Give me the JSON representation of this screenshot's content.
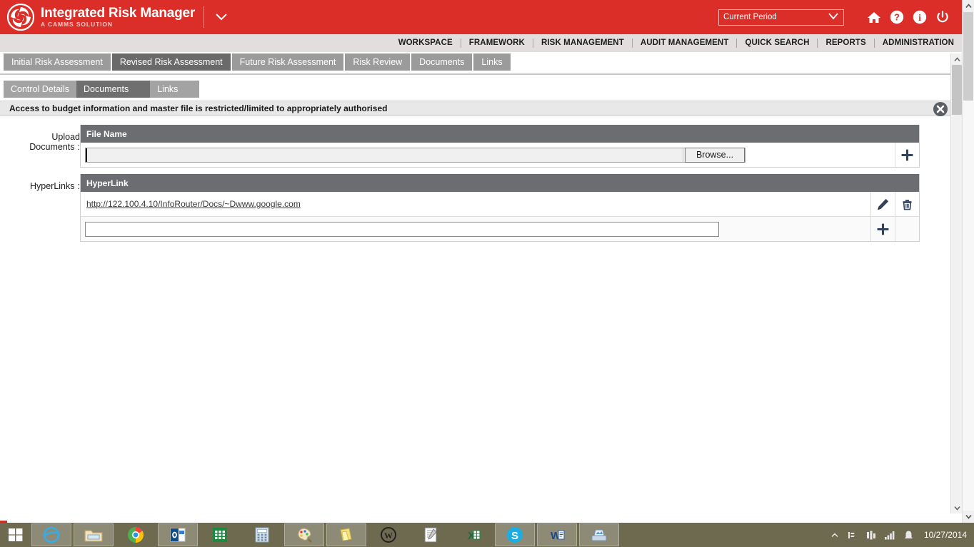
{
  "header": {
    "brand_title": "Integrated Risk Manager",
    "brand_subtitle": "A CAMMS SOLUTION",
    "period_selected": "Current Period",
    "icons": [
      "home-icon",
      "help-icon",
      "info-icon",
      "power-icon"
    ]
  },
  "nav": {
    "items": [
      "WORKSPACE",
      "FRAMEWORK",
      "RISK MANAGEMENT",
      "AUDIT MANAGEMENT",
      "QUICK SEARCH",
      "REPORTS",
      "ADMINISTRATION"
    ]
  },
  "tabs_primary": [
    {
      "label": "Initial Risk Assessment",
      "active": false
    },
    {
      "label": "Revised Risk Assessment",
      "active": true
    },
    {
      "label": "Future Risk Assessment",
      "active": false
    },
    {
      "label": "Risk Review",
      "active": false
    },
    {
      "label": "Documents",
      "active": false
    },
    {
      "label": "Links",
      "active": false
    }
  ],
  "tabs_secondary": [
    {
      "label": "Control Details",
      "active": false
    },
    {
      "label": "Documents",
      "active": true
    },
    {
      "label": "Links",
      "active": false
    }
  ],
  "subheader": {
    "text": "Access to budget information and master file is restricted/limited to appropriately authorised",
    "close_icon": "close-circle-icon"
  },
  "upload_documents": {
    "label": "Upload Documents",
    "colon": ":",
    "column_header": "File Name",
    "file_value": "",
    "browse_label": "Browse...",
    "add_icon": "plus-icon"
  },
  "hyperlinks": {
    "label": "HyperLinks",
    "colon": ":",
    "column_header": "HyperLink",
    "rows": [
      {
        "url": "http://122.100.4.10/InfoRouter/Docs/~Dwww.google.com",
        "edit_icon": "pencil-icon",
        "delete_icon": "trash-icon"
      }
    ],
    "new_value": "",
    "add_icon": "plus-icon"
  },
  "taskbar": {
    "start_label": "start-button",
    "items": [
      "internet-explorer-icon",
      "file-explorer-icon",
      "chrome-icon",
      "outlook-icon",
      "excel-green-icon",
      "calculator-icon",
      "paint-icon",
      "sticky-notes-icon",
      "wordpad-icon",
      "notepad-icon",
      "excel-icon",
      "skype-icon",
      "word-icon",
      "scanner-icon"
    ],
    "tray_icons": [
      "show-hidden-icon",
      "network-icon",
      "volume-icon",
      "signal-icon",
      "action-center-icon"
    ],
    "date": "10/27/2014"
  },
  "colors": {
    "brand_red": "#db2e28",
    "grid_header_gray": "#6b6d70",
    "tab_active_gray": "#6a6a6a",
    "tab_inactive_gray": "#9b9b9b",
    "icon_navy": "#33415a"
  }
}
